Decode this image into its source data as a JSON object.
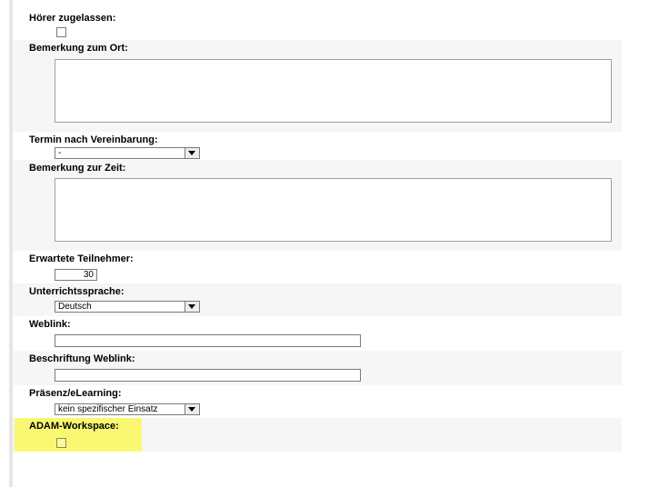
{
  "form": {
    "hoerer_zugelassen": {
      "label": "Hörer zugelassen:"
    },
    "bemerkung_ort": {
      "label": "Bemerkung zum Ort:"
    },
    "termin": {
      "label": "Termin nach Vereinbarung:",
      "selected": "-"
    },
    "bemerkung_zeit": {
      "label": "Bemerkung zur Zeit:"
    },
    "teilnehmer": {
      "label": "Erwartete Teilnehmer:",
      "value": "30"
    },
    "sprache": {
      "label": "Unterrichtssprache:",
      "selected": "Deutsch"
    },
    "weblink": {
      "label": "Weblink:"
    },
    "beschriftung_weblink": {
      "label": "Beschriftung Weblink:"
    },
    "praesenz": {
      "label": "Präsenz/eLearning:",
      "selected": "kein spezifischer Einsatz"
    },
    "adam_workspace": {
      "label": "ADAM-Workspace:",
      "highlight_color": "#faf873"
    }
  }
}
